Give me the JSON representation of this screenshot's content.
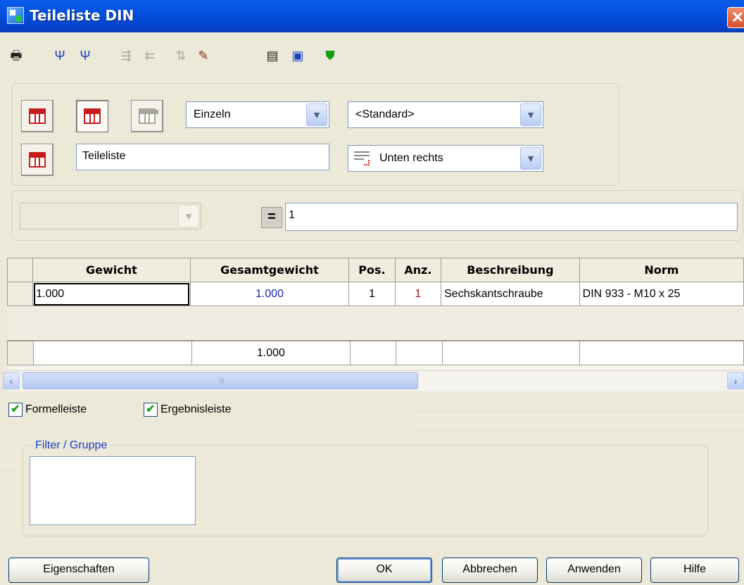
{
  "window": {
    "title": "Teileliste DIN",
    "close_glyph": "✕"
  },
  "toolbar": {
    "buttons": [
      {
        "name": "print-icon",
        "glyph": "🖶",
        "enabled": true
      },
      {
        "name": "tree-down-icon",
        "glyph": "Ψ",
        "enabled": true
      },
      {
        "name": "tree-up-icon",
        "glyph": "Ψ",
        "enabled": true
      },
      {
        "name": "move-right-icon",
        "glyph": "⇶",
        "enabled": false
      },
      {
        "name": "move-left-icon",
        "glyph": "⇇",
        "enabled": false
      },
      {
        "name": "sort-icon",
        "glyph": "⇅",
        "enabled": false
      },
      {
        "name": "edit-icon",
        "glyph": "✎",
        "enabled": true
      },
      {
        "name": "list-icon",
        "glyph": "▤",
        "enabled": true
      },
      {
        "name": "save-icon",
        "glyph": "▣",
        "enabled": true
      },
      {
        "name": "shield-icon",
        "glyph": "⛊",
        "enabled": true
      }
    ]
  },
  "settings": {
    "mode_select": "Einzeln",
    "style_select": "<Standard>",
    "name_input": "Teileliste",
    "position_select": "Unten rechts"
  },
  "formula": {
    "column_select": "",
    "equals": "=",
    "value": "1"
  },
  "grid": {
    "columns": [
      "Gewicht",
      "Gesamtgewicht",
      "Pos.",
      "Anz.",
      "Beschreibung",
      "Norm"
    ],
    "rows": [
      [
        "1.000",
        "1.000",
        "1",
        "1",
        "Sechskantschraube",
        "DIN 933 - M10  x 25"
      ]
    ],
    "summary": [
      "",
      "1.000",
      "",
      "",
      "",
      ""
    ],
    "scroll_left": "‹",
    "scroll_right": "›",
    "scroll_grip": "III"
  },
  "options": {
    "formelleiste": "Formelleiste",
    "ergebnisleiste": "Ergebnisleiste",
    "check": "✔"
  },
  "filter": {
    "legend": "Filter / Gruppe"
  },
  "buttons": {
    "eigenschaften": "Eigenschaften",
    "ok": "OK",
    "abbrechen": "Abbrechen",
    "anwenden": "Anwenden",
    "hilfe": "Hilfe"
  },
  "colors": {
    "titlebar": "#0553e0",
    "accent_blue": "#1a2aaa",
    "accent_red": "#b01818",
    "check_green": "#21a121"
  }
}
